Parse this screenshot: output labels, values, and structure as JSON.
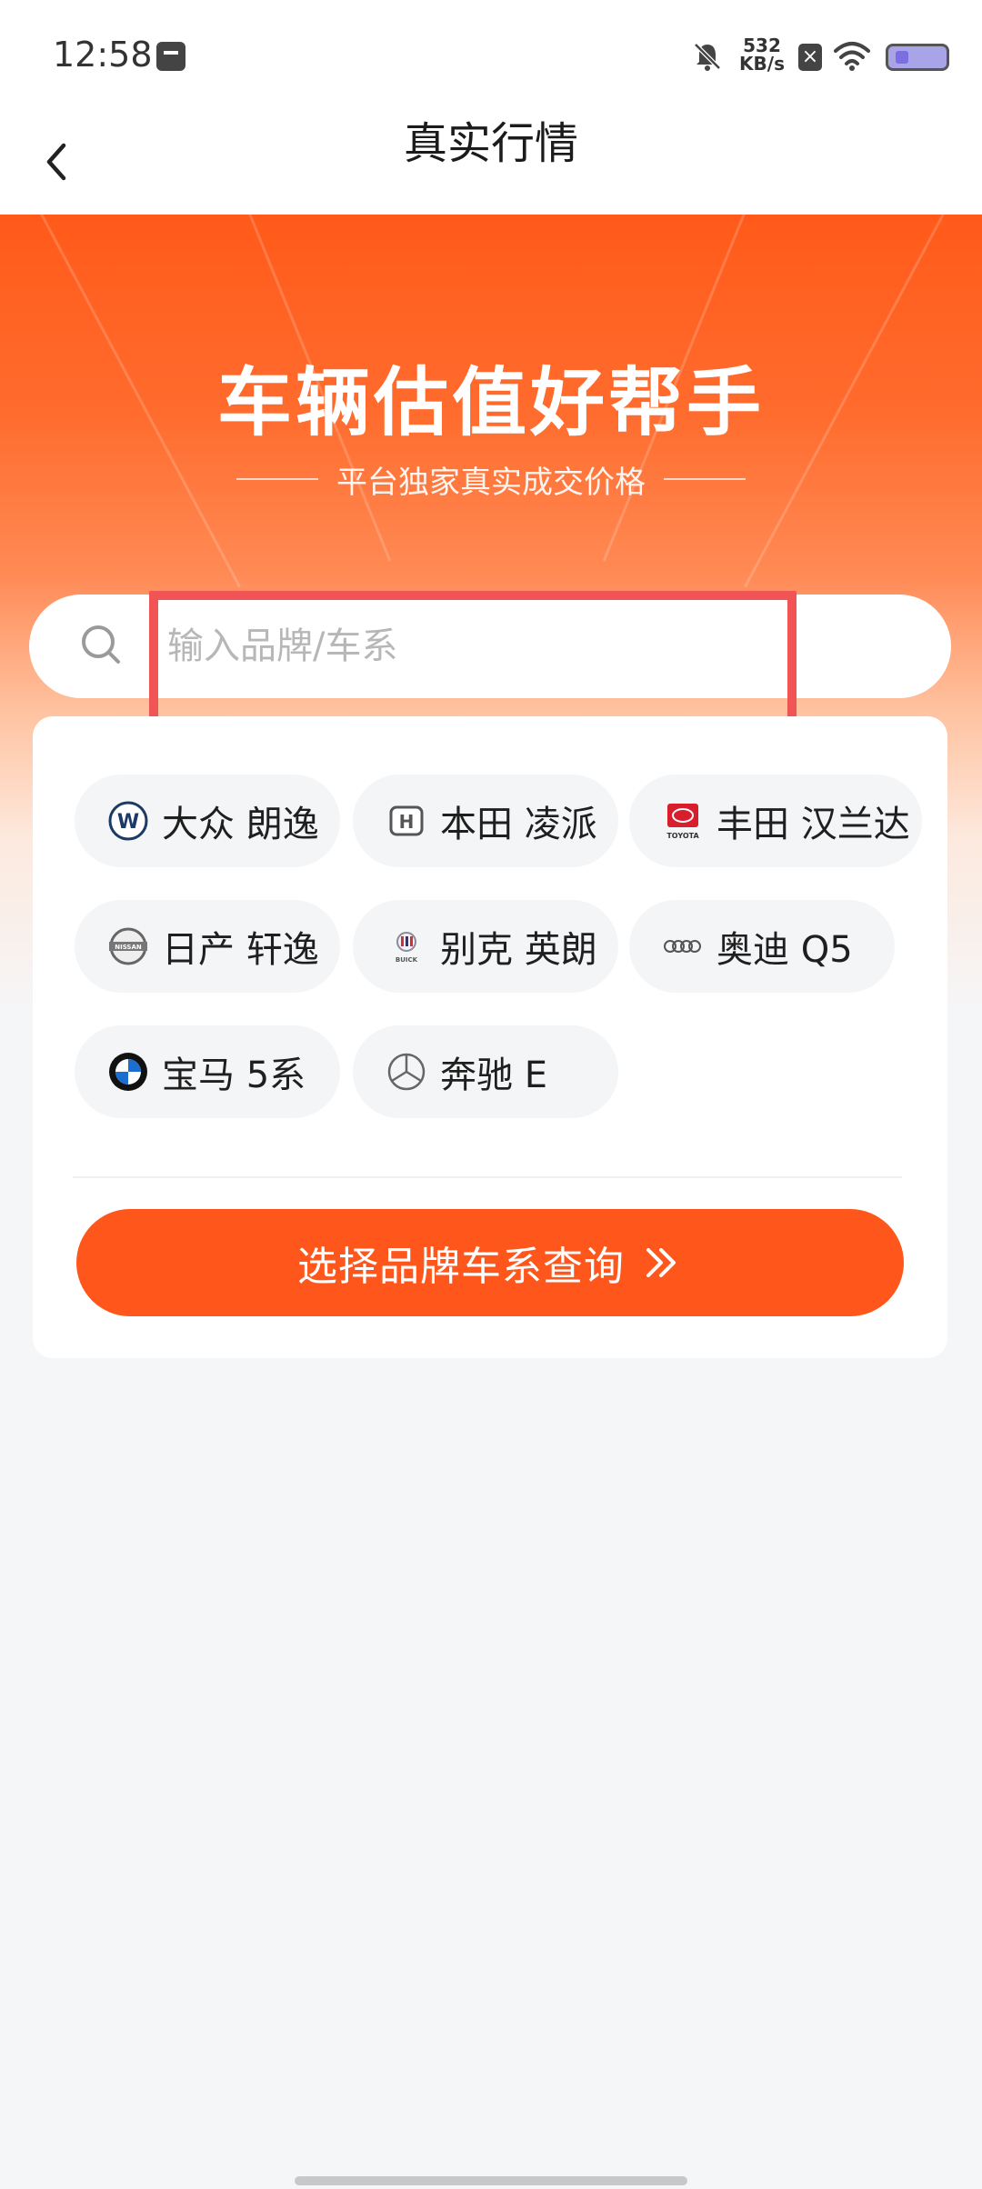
{
  "status_bar": {
    "time": "12:58",
    "net_speed_value": "532",
    "net_speed_unit": "KB/s"
  },
  "nav": {
    "title": "真实行情"
  },
  "hero": {
    "title": "车辆估值好帮手",
    "subtitle": "平台独家真实成交价格"
  },
  "search": {
    "placeholder": "输入品牌/车系"
  },
  "hot_models": [
    {
      "brand_icon": "volkswagen-logo",
      "label": "大众 朗逸"
    },
    {
      "brand_icon": "honda-logo",
      "label": "本田 凌派"
    },
    {
      "brand_icon": "toyota-logo",
      "label": "丰田 汉兰达"
    },
    {
      "brand_icon": "nissan-logo",
      "label": "日产 轩逸"
    },
    {
      "brand_icon": "buick-logo",
      "label": "别克 英朗"
    },
    {
      "brand_icon": "audi-logo",
      "label": "奥迪 Q5"
    },
    {
      "brand_icon": "bmw-logo",
      "label": "宝马 5系"
    },
    {
      "brand_icon": "mercedes-logo",
      "label": "奔驰 E"
    }
  ],
  "query_button": {
    "label": "选择品牌车系查询"
  },
  "colors": {
    "accent": "#ff561c",
    "highlight": "#f05454"
  }
}
